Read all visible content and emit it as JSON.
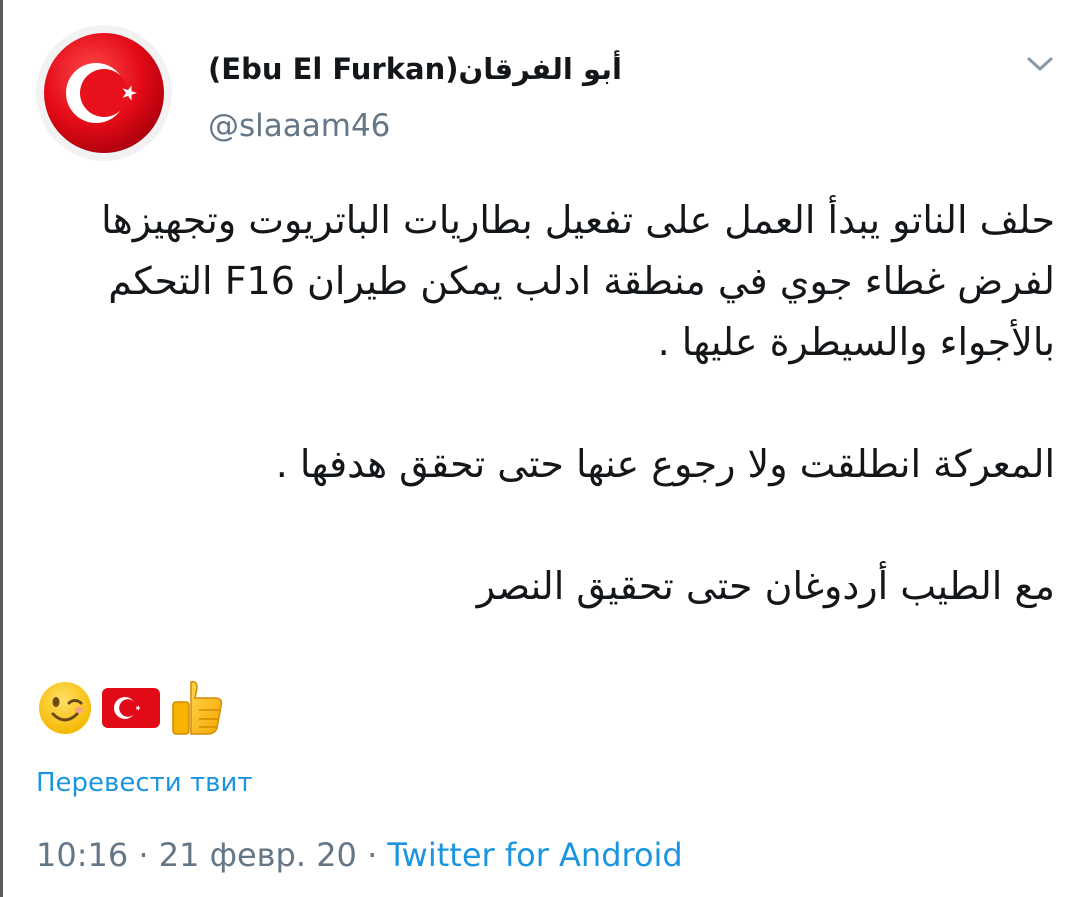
{
  "author": {
    "display_name": "(Ebu El Furkan)أبو الفرقان",
    "handle": "@slaaam46",
    "avatar_icon": "turkish-flag-avatar"
  },
  "menu": {
    "icon": "chevron-down-icon"
  },
  "tweet": {
    "paragraph_1": "حلف الناتو  يبدأ العمل على تفعيل بطاريات الباتريوت وتجهيزها  لفرض غطاء جوي في منطقة ادلب يمكن طيران F16 التحكم بالأجواء والسيطرة عليها .",
    "paragraph_2": "المعركة انطلقت ولا رجوع عنها حتى تحقق هدفها  .",
    "paragraph_3": "مع الطيب أردوغان حتى تحقيق النصر",
    "emojis": [
      "winking-face-emoji",
      "turkish-flag-emoji",
      "thumbs-up-emoji"
    ]
  },
  "actions": {
    "translate_label": "Перевести твит"
  },
  "meta": {
    "time": "10:16",
    "separator": " · ",
    "date": "21 февр. 20",
    "source": "Twitter for Android"
  },
  "colors": {
    "link": "#1b95e0",
    "secondary_text": "#657786",
    "primary_text": "#14171a",
    "flag_red": "#e30a17"
  }
}
